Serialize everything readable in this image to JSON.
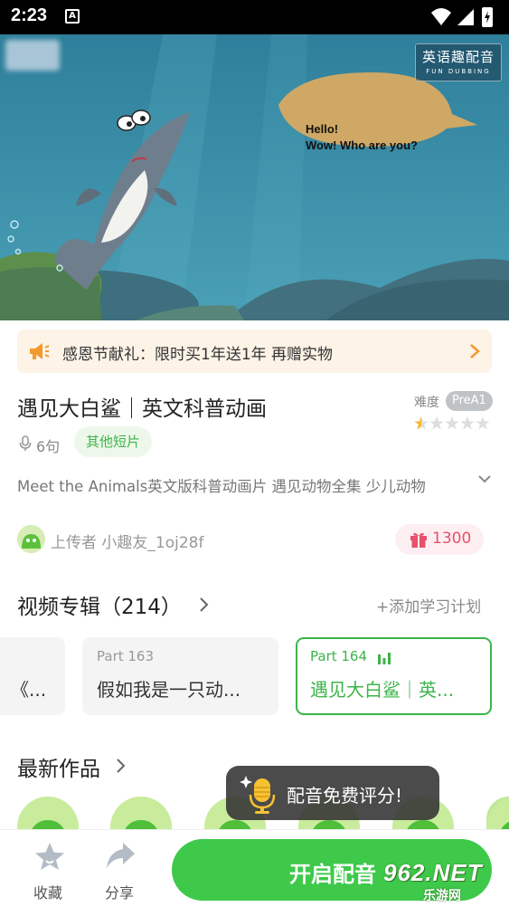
{
  "status_bar": {
    "time": "2:23",
    "notification_icon": "a-letter-icon",
    "icons": [
      "wifi-icon",
      "signal-icon",
      "battery-charging-icon"
    ]
  },
  "video": {
    "logo_line1": "英语趣配音",
    "logo_line2": "FUN DUBBING",
    "bubble_line1": "Hello!",
    "bubble_line2": "Wow! Who are you?"
  },
  "promo": {
    "text": "感恩节献礼：限时买1年送1年 再赠实物",
    "icon": "megaphone-icon"
  },
  "lesson": {
    "title": "遇见大白鲨｜英文科普动画",
    "difficulty_label": "难度",
    "difficulty_level": "PreA1",
    "rating": 0.5,
    "rating_max": 5,
    "sentences": "6句",
    "category": "其他短片",
    "description": "Meet the Animals英文版科普动画片 遇见动物全集 少儿动物"
  },
  "uploader": {
    "text": "上传者 小趣友_1oj28f",
    "gift_count": "1300"
  },
  "album": {
    "title": "视频专辑（214）",
    "add_plan": "+添加学习计划",
    "cards": [
      {
        "part": "",
        "name": "《..."
      },
      {
        "part": "Part 163",
        "name": "假如我是一只动..."
      },
      {
        "part": "Part 164",
        "name": "遇见大白鲨｜英..."
      }
    ]
  },
  "latest": {
    "title": "最新作品"
  },
  "toast": {
    "text": "配音免费评分!"
  },
  "bottom_bar": {
    "favorite_label": "收藏",
    "share_label": "分享",
    "start_label": "开启配音"
  },
  "watermark": {
    "brand": "962.NET",
    "sub": "乐游网"
  },
  "colors": {
    "accent_green": "#3ec94b",
    "promo_bg": "#fdf3e7",
    "gift_pink": "#e8506b"
  }
}
